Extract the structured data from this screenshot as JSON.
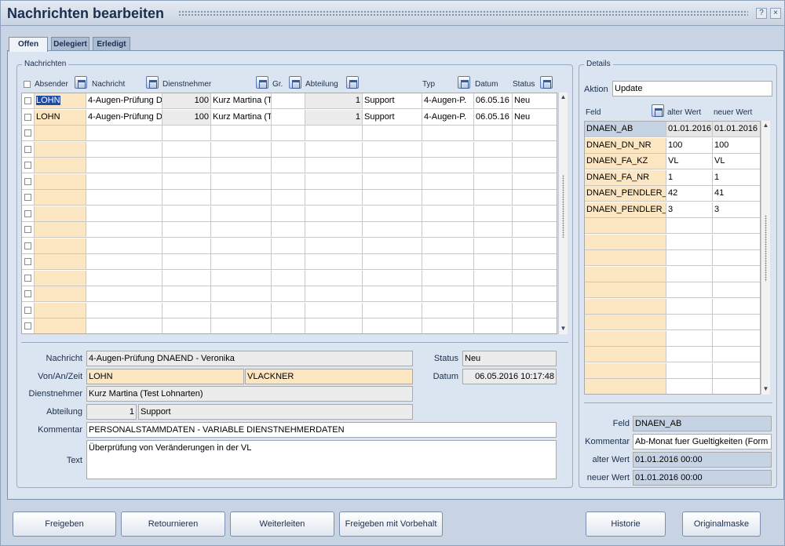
{
  "window": {
    "title": "Nachrichten bearbeiten",
    "btn_help": "?",
    "btn_close": "×"
  },
  "tabs": [
    "Offen",
    "Delegiert",
    "Erledigt"
  ],
  "nachrichten": {
    "legend": "Nachrichten",
    "columns": [
      "Absender",
      "Nachricht",
      "Dienstnehmer",
      "Gr.",
      "Abteilung",
      "Typ",
      "Datum",
      "Status"
    ],
    "rows": [
      [
        "LOHN",
        "4-Augen-Prüfung D",
        "100",
        "Kurz Martina (TANG",
        "",
        "1",
        "Support",
        "4-Augen-P.",
        "06.05.16",
        "Neu"
      ],
      [
        "LOHN",
        "4-Augen-Prüfung D",
        "100",
        "Kurz Martina (TANG",
        "",
        "1",
        "Support",
        "4-Augen-P.",
        "06.05.16",
        "Neu"
      ]
    ]
  },
  "detail_form": {
    "nachricht_label": "Nachricht",
    "nachricht_value": "4-Augen-Prüfung DNAEND - Veronika",
    "vonanzeit_label": "Von/An/Zeit",
    "von_value": "LOHN",
    "an_value": "VLACKNER",
    "dienstnehmer_label": "Dienstnehmer",
    "dienstnehmer_value": "Kurz Martina (Test Lohnarten)",
    "abteilung_label": "Abteilung",
    "abteilung_nr": "1",
    "abteilung_value": "Support",
    "kommentar_label": "Kommentar",
    "kommentar_value": "PERSONALSTAMMDATEN - VARIABLE DIENSTNEHMERDATEN",
    "text_label": "Text",
    "text_value": "Überprüfung von Veränderungen in der VL",
    "status_label": "Status",
    "status_value": "Neu",
    "datum_label": "Datum",
    "datum_value": "06.05.2016 10:17:48"
  },
  "details": {
    "legend": "Details",
    "aktion_label": "Aktion",
    "aktion_value": "Update",
    "columns": [
      "Feld",
      "alter Wert",
      "neuer Wert"
    ],
    "rows": [
      [
        "DNAEN_AB",
        "01.01.2016",
        "01.01.2016"
      ],
      [
        "DNAEN_DN_NR",
        "100",
        "100"
      ],
      [
        "DNAEN_FA_KZ",
        "VL",
        "VL"
      ],
      [
        "DNAEN_FA_NR",
        "1",
        "1"
      ],
      [
        "DNAEN_PENDLER_I",
        "42",
        "41"
      ],
      [
        "DNAEN_PENDLER_T",
        "3",
        "3"
      ]
    ],
    "feld_label": "Feld",
    "feld_value": "DNAEN_AB",
    "kommentar_label": "Kommentar",
    "kommentar_value": "Ab-Monat fuer Gueltigkeiten (Form",
    "alter_label": "alter Wert",
    "alter_value": "01.01.2016 00:00",
    "neuer_label": "neuer Wert",
    "neuer_value": "01.01.2016 00:00"
  },
  "buttons": [
    "Freigeben",
    "Retournieren",
    "Weiterleiten",
    "Freigeben mit Vorbehalt",
    "Historie",
    "Originalmaske"
  ]
}
